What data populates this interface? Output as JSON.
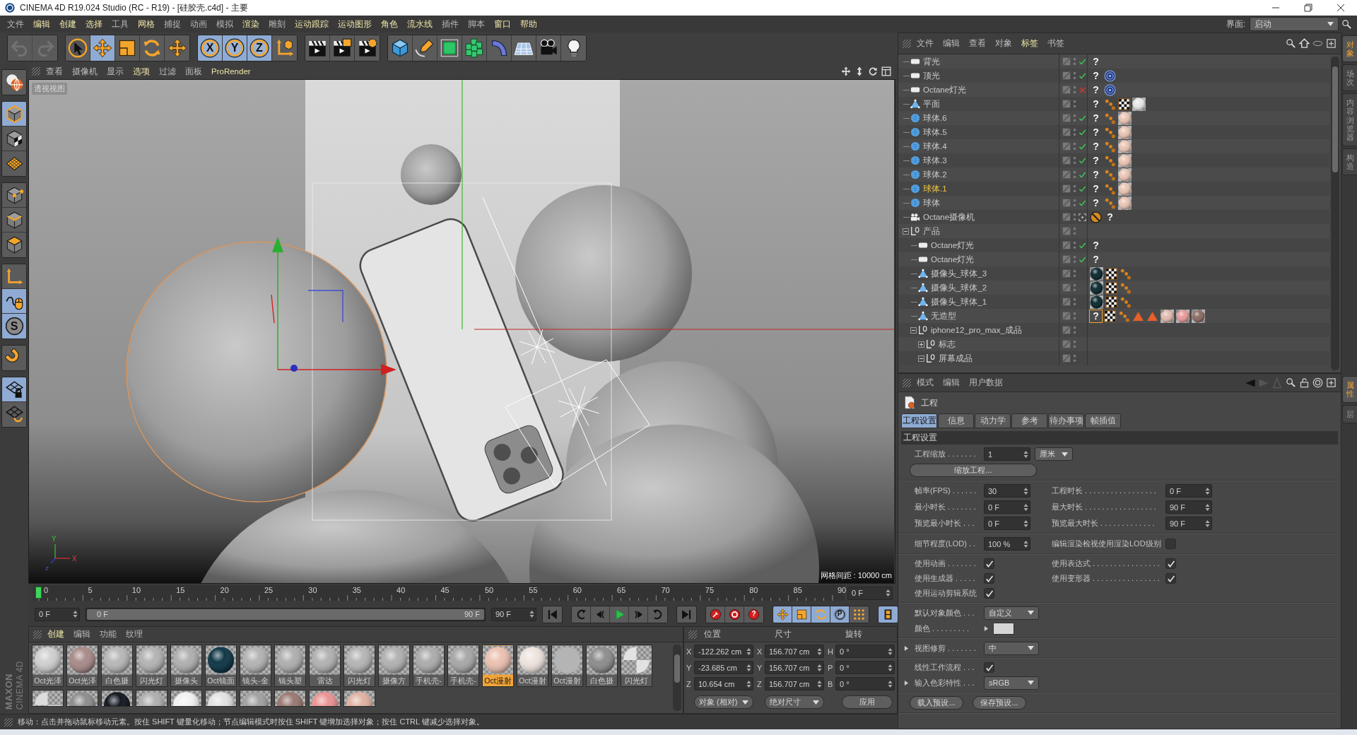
{
  "window": {
    "title": "CINEMA 4D R19.024 Studio (RC - R19) - [硅胶壳.c4d] - 主要"
  },
  "menu_bar": {
    "items": [
      {
        "label": "文件",
        "highlighted": false
      },
      {
        "label": "编辑",
        "highlighted": true
      },
      {
        "label": "创建",
        "highlighted": true
      },
      {
        "label": "选择",
        "highlighted": true
      },
      {
        "label": "工具",
        "highlighted": false
      },
      {
        "label": "网格",
        "highlighted": true
      },
      {
        "label": "捕捉",
        "highlighted": false
      },
      {
        "label": "动画",
        "highlighted": false
      },
      {
        "label": "模拟",
        "highlighted": false
      },
      {
        "label": "渲染",
        "highlighted": true
      },
      {
        "label": "雕刻",
        "highlighted": false
      },
      {
        "label": "运动跟踪",
        "highlighted": true
      },
      {
        "label": "运动图形",
        "highlighted": true
      },
      {
        "label": "角色",
        "highlighted": true
      },
      {
        "label": "流水线",
        "highlighted": true
      },
      {
        "label": "插件",
        "highlighted": false
      },
      {
        "label": "脚本",
        "highlighted": false
      },
      {
        "label": "窗口",
        "highlighted": true
      },
      {
        "label": "帮助",
        "highlighted": true
      }
    ],
    "layout_label": "界面:",
    "layout_value": "启动"
  },
  "toolbar": {
    "groups": [
      {
        "buttons": [
          {
            "kind": "undo",
            "selected": false,
            "disabled": true
          },
          {
            "kind": "redo",
            "selected": false,
            "disabled": true
          }
        ]
      },
      {
        "buttons": [
          {
            "kind": "select",
            "selected": false,
            "disabled": false
          },
          {
            "kind": "move",
            "selected": true,
            "disabled": false
          },
          {
            "kind": "scale",
            "selected": false,
            "disabled": false
          },
          {
            "kind": "rotate",
            "selected": false,
            "disabled": false
          },
          {
            "kind": "move",
            "selected": false,
            "disabled": false
          }
        ]
      },
      {
        "buttons": [
          {
            "kind": "axis",
            "label": "X",
            "selected": true,
            "disabled": false
          },
          {
            "kind": "axis",
            "label": "Y",
            "selected": true,
            "disabled": false
          },
          {
            "kind": "axis",
            "label": "Z",
            "selected": true,
            "disabled": false
          },
          {
            "kind": "coordinates",
            "selected": false,
            "disabled": false
          }
        ]
      },
      {
        "buttons": [
          {
            "kind": "render-view",
            "selected": false,
            "disabled": false
          },
          {
            "kind": "render-picture",
            "selected": false,
            "disabled": false
          },
          {
            "kind": "render-settings",
            "selected": false,
            "disabled": false
          }
        ]
      },
      {
        "buttons": [
          {
            "kind": "cube",
            "selected": false,
            "disabled": false
          },
          {
            "kind": "pen",
            "selected": false,
            "disabled": false
          },
          {
            "kind": "subdivision",
            "selected": false,
            "disabled": false
          },
          {
            "kind": "cloner",
            "selected": false,
            "disabled": false
          },
          {
            "kind": "deformer",
            "selected": false,
            "disabled": false
          },
          {
            "kind": "floor",
            "selected": false,
            "disabled": false
          },
          {
            "kind": "camera",
            "selected": false,
            "disabled": false
          },
          {
            "kind": "light",
            "selected": false,
            "disabled": false
          }
        ]
      }
    ]
  },
  "tool_strip": {
    "groups": [
      {
        "buttons": [
          {
            "kind": "make-editable",
            "selected": false
          }
        ]
      },
      {
        "buttons": [
          {
            "kind": "model",
            "selected": true
          },
          {
            "kind": "texture",
            "selected": false
          },
          {
            "kind": "workplane",
            "selected": false
          }
        ]
      },
      {
        "buttons": [
          {
            "kind": "points",
            "selected": false
          },
          {
            "kind": "edges",
            "selected": false
          },
          {
            "kind": "polygons",
            "selected": false
          }
        ]
      },
      {
        "buttons": [
          {
            "kind": "axis-mode",
            "selected": false
          },
          {
            "kind": "tweak",
            "selected": true
          },
          {
            "kind": "solo",
            "label": "S",
            "selected": true
          }
        ]
      },
      {
        "buttons": [
          {
            "kind": "snap",
            "selected": false
          }
        ]
      },
      {
        "buttons": [
          {
            "kind": "lock-workplane",
            "selected": true
          },
          {
            "kind": "planar-workplane",
            "selected": false
          }
        ]
      }
    ]
  },
  "viewport": {
    "menu": [
      {
        "label": "查看",
        "highlighted": false
      },
      {
        "label": "摄像机",
        "highlighted": false
      },
      {
        "label": "显示",
        "highlighted": false
      },
      {
        "label": "选项",
        "highlighted": true
      },
      {
        "label": "过滤",
        "highlighted": false
      },
      {
        "label": "面板",
        "highlighted": false
      },
      {
        "label": "ProRender",
        "highlighted": true
      }
    ],
    "view_name": "透视视图",
    "axis_labels": [
      "Y",
      "X",
      "Z"
    ],
    "grid_spacing": "网格间距 : 10000 cm"
  },
  "timeline": {
    "ticks": [
      "0",
      "5",
      "10",
      "15",
      "20",
      "25",
      "30",
      "35",
      "40",
      "45",
      "50",
      "55",
      "60",
      "65",
      "70",
      "75",
      "80",
      "85",
      "90"
    ],
    "level": 0,
    "current_frame": "0 F"
  },
  "transport": {
    "start": "0 F",
    "range": {
      "start": "0 F",
      "end": "90 F",
      "level": 1
    },
    "end": "90 F",
    "groups": [
      {
        "buttons": [
          {
            "kind": "first",
            "selected": false
          }
        ]
      },
      {
        "buttons": [
          {
            "kind": "prev-key",
            "selected": false
          },
          {
            "kind": "prev-frame",
            "selected": false
          },
          {
            "kind": "play",
            "selected": false
          },
          {
            "kind": "next-frame",
            "selected": false
          },
          {
            "kind": "next-key",
            "selected": false
          }
        ]
      },
      {
        "buttons": [
          {
            "kind": "last",
            "selected": false
          }
        ]
      },
      {
        "buttons": [
          {
            "kind": "record",
            "selected": false
          },
          {
            "kind": "autokey",
            "selected": false
          },
          {
            "kind": "key-help",
            "label": "?",
            "selected": false
          }
        ]
      },
      {
        "buttons": [
          {
            "kind": "move",
            "selected": true
          },
          {
            "kind": "scale",
            "selected": true
          },
          {
            "kind": "rotate",
            "selected": true
          },
          {
            "kind": "param",
            "label": "P",
            "selected": true
          },
          {
            "kind": "dot-grid",
            "selected": false
          }
        ]
      },
      {
        "buttons": [
          {
            "kind": "film",
            "selected": true
          }
        ]
      }
    ]
  },
  "materials": {
    "menu": [
      {
        "label": "创建",
        "highlighted": true
      },
      {
        "label": "编辑",
        "highlighted": false
      },
      {
        "label": "功能",
        "highlighted": false
      },
      {
        "label": "纹理",
        "highlighted": false
      }
    ],
    "items": [
      {
        "name": "Oct光泽",
        "kind": "sphere",
        "color": "#d0d0d0",
        "selected": false
      },
      {
        "name": "Oct光泽",
        "kind": "sphere",
        "color": "#a88c8a",
        "selected": false
      },
      {
        "name": "白色摄",
        "kind": "sphere",
        "color": "#b8b8b8",
        "selected": false
      },
      {
        "name": "闪光灯",
        "kind": "sphere",
        "color": "#b4b4b4",
        "selected": false
      },
      {
        "name": "摄像头",
        "kind": "sphere",
        "color": "#b0b0b0",
        "selected": false
      },
      {
        "name": "Oct镜面",
        "kind": "sphere",
        "color": "#123848",
        "selected": false
      },
      {
        "name": "镜头-金",
        "kind": "sphere",
        "color": "#b4b4b4",
        "selected": false
      },
      {
        "name": "镜头塑",
        "kind": "sphere",
        "color": "#b0b0b0",
        "selected": false
      },
      {
        "name": "雷达",
        "kind": "sphere",
        "color": "#b2b2b2",
        "selected": false
      },
      {
        "name": "闪光灯",
        "kind": "sphere",
        "color": "#b6b6b6",
        "selected": false
      },
      {
        "name": "摄像方",
        "kind": "sphere",
        "color": "#b2b2b2",
        "selected": false
      },
      {
        "name": "手机壳-",
        "kind": "sphere",
        "color": "#adadad",
        "selected": false
      },
      {
        "name": "手机壳-",
        "kind": "sphere",
        "color": "#a8a8a8",
        "selected": false
      },
      {
        "name": "Oct漫射",
        "kind": "sphere",
        "color": "#ecc2b2",
        "selected": true
      },
      {
        "name": "Oct漫射",
        "kind": "sphere",
        "color": "#eee4de",
        "selected": false
      },
      {
        "name": "Oct漫射",
        "kind": "flat",
        "color": "#b4b4b4",
        "selected": false
      },
      {
        "name": "白色摄",
        "kind": "sphere",
        "color": "#8e8e8e",
        "selected": false
      },
      {
        "name": "闪光灯",
        "kind": "checker",
        "color": "#e2e2e2",
        "selected": false
      }
    ],
    "items_row_2": [
      {
        "kind": "checker",
        "color": "#dcdcdc",
        "selected": false
      },
      {
        "kind": "sphere",
        "color": "#8e8e8e",
        "selected": false
      },
      {
        "kind": "sphere",
        "color": "#151a22",
        "selected": false
      },
      {
        "kind": "sphere",
        "color": "#b0b0b0",
        "selected": false
      },
      {
        "kind": "sphere",
        "color": "#f2f2f2",
        "selected": false
      },
      {
        "kind": "sphere",
        "color": "#e2e2e2",
        "selected": false
      },
      {
        "kind": "sphere",
        "color": "#a2a2a2",
        "selected": false
      },
      {
        "kind": "sphere",
        "color": "#9a7a72",
        "selected": false
      },
      {
        "kind": "sphere",
        "color": "#ea9494",
        "selected": false
      },
      {
        "kind": "sphere",
        "color": "#e0b2a4",
        "selected": false
      }
    ]
  },
  "coordinates": {
    "columns": [
      {
        "title": "位置",
        "fields": [
          {
            "axis": "X",
            "value": "-122.262 cm"
          },
          {
            "axis": "Y",
            "value": "-23.685 cm"
          },
          {
            "axis": "Z",
            "value": "10.654 cm"
          }
        ]
      },
      {
        "title": "尺寸",
        "fields": [
          {
            "axis": "X",
            "value": "156.707 cm"
          },
          {
            "axis": "Y",
            "value": "156.707 cm"
          },
          {
            "axis": "Z",
            "value": "156.707 cm"
          }
        ]
      },
      {
        "title": "旋转",
        "fields": [
          {
            "axis": "H",
            "value": "0 °"
          },
          {
            "axis": "P",
            "value": "0 °"
          },
          {
            "axis": "B",
            "value": "0 °"
          }
        ]
      }
    ],
    "mode_dropdowns": [
      "对象 (相对)",
      "绝对尺寸"
    ],
    "apply_button": "应用"
  },
  "status_bar": {
    "text": "移动：点击并拖动鼠标移动元素。按住 SHIFT 键量化移动；节点编辑模式时按住 SHIFT 键增加选择对象；按住 CTRL 键减少选择对象。"
  },
  "logo": {
    "brand": "MAXON",
    "product": "CINEMA 4D"
  },
  "object_manager": {
    "menu": [
      {
        "label": "文件",
        "highlighted": false
      },
      {
        "label": "编辑",
        "highlighted": false
      },
      {
        "label": "查看",
        "highlighted": false
      },
      {
        "label": "对象",
        "highlighted": false
      },
      {
        "label": "标签",
        "highlighted": true
      },
      {
        "label": "书签",
        "highlighted": false
      }
    ],
    "objects": [
      {
        "name": "背光",
        "kind": "light",
        "selected": false,
        "enabled": true,
        "tags": [
          {
            "kind": "text",
            "label": "?",
            "selected": false
          }
        ]
      },
      {
        "name": "顶光",
        "kind": "light",
        "selected": false,
        "enabled": true,
        "tags": [
          {
            "kind": "text",
            "label": "?",
            "selected": false
          },
          {
            "kind": "target",
            "selected": false
          }
        ]
      },
      {
        "name": "Octane灯光",
        "kind": "light",
        "selected": false,
        "enabled": false,
        "tags": [
          {
            "kind": "text",
            "label": "?",
            "selected": false
          },
          {
            "kind": "target",
            "selected": false
          }
        ]
      },
      {
        "name": "平面",
        "kind": "polygon",
        "selected": false,
        "tags": [
          {
            "kind": "text",
            "label": "?",
            "selected": false
          },
          {
            "kind": "dots",
            "selected": false
          },
          {
            "kind": "checker",
            "selected": false
          },
          {
            "kind": "material",
            "color": "#e8e6e4",
            "selected": false
          }
        ]
      },
      {
        "name": "球体.6",
        "kind": "sphere",
        "selected": false,
        "enabled": true,
        "tags": [
          {
            "kind": "text",
            "label": "?",
            "selected": false
          },
          {
            "kind": "dots",
            "selected": false
          },
          {
            "kind": "material",
            "color": "#eac6b6",
            "selected": false
          }
        ]
      },
      {
        "name": "球体.5",
        "kind": "sphere",
        "selected": false,
        "enabled": true,
        "tags": [
          {
            "kind": "text",
            "label": "?",
            "selected": false
          },
          {
            "kind": "dots",
            "selected": false
          },
          {
            "kind": "material",
            "color": "#eac6b6",
            "selected": false
          }
        ]
      },
      {
        "name": "球体.4",
        "kind": "sphere",
        "selected": false,
        "enabled": true,
        "tags": [
          {
            "kind": "text",
            "label": "?",
            "selected": false
          },
          {
            "kind": "dots",
            "selected": false
          },
          {
            "kind": "material",
            "color": "#eac6b6",
            "selected": false
          }
        ]
      },
      {
        "name": "球体.3",
        "kind": "sphere",
        "selected": false,
        "enabled": true,
        "tags": [
          {
            "kind": "text",
            "label": "?",
            "selected": false
          },
          {
            "kind": "dots",
            "selected": false
          },
          {
            "kind": "material",
            "color": "#eac6b6",
            "selected": false
          }
        ]
      },
      {
        "name": "球体.2",
        "kind": "sphere",
        "selected": false,
        "enabled": true,
        "tags": [
          {
            "kind": "text",
            "label": "?",
            "selected": false
          },
          {
            "kind": "dots",
            "selected": false
          },
          {
            "kind": "material",
            "color": "#eac6b6",
            "selected": false
          }
        ]
      },
      {
        "name": "球体.1",
        "kind": "sphere",
        "selected": true,
        "enabled": true,
        "tags": [
          {
            "kind": "text",
            "label": "?",
            "selected": false
          },
          {
            "kind": "dots",
            "selected": false
          },
          {
            "kind": "material",
            "color": "#eac6b6",
            "selected": false
          }
        ]
      },
      {
        "name": "球体",
        "kind": "sphere",
        "selected": false,
        "enabled": true,
        "tags": [
          {
            "kind": "text",
            "label": "?",
            "selected": false
          },
          {
            "kind": "dots",
            "selected": false
          },
          {
            "kind": "material",
            "color": "#eac6b6",
            "selected": false
          }
        ]
      },
      {
        "name": "Octane摄像机",
        "kind": "camera",
        "selected": false,
        "tags": [
          {
            "kind": "no-entry",
            "selected": false
          },
          {
            "kind": "text",
            "label": "?",
            "selected": false
          }
        ]
      },
      {
        "name": "产品",
        "kind": "null",
        "selected": false,
        "expanded": true,
        "children": [
          {
            "name": "Octane灯光",
            "kind": "light",
            "selected": false,
            "enabled": true,
            "tags": [
              {
                "kind": "text",
                "label": "?",
                "selected": false
              }
            ]
          },
          {
            "name": "Octane灯光",
            "kind": "light",
            "selected": false,
            "enabled": true,
            "tags": [
              {
                "kind": "text",
                "label": "?",
                "selected": false
              }
            ]
          },
          {
            "name": "摄像头_球体_3",
            "kind": "polygon",
            "selected": false,
            "tags": [
              {
                "kind": "material",
                "color": "#0f2c32",
                "selected": false
              },
              {
                "kind": "checker",
                "selected": false
              },
              {
                "kind": "dots",
                "selected": false
              }
            ]
          },
          {
            "name": "摄像头_球体_2",
            "kind": "polygon",
            "selected": false,
            "tags": [
              {
                "kind": "material",
                "color": "#0f2c32",
                "selected": false
              },
              {
                "kind": "checker",
                "selected": false
              },
              {
                "kind": "dots",
                "selected": false
              }
            ]
          },
          {
            "name": "摄像头_球体_1",
            "kind": "polygon",
            "selected": false,
            "tags": [
              {
                "kind": "material",
                "color": "#0f2c32",
                "selected": false
              },
              {
                "kind": "checker",
                "selected": false
              },
              {
                "kind": "dots",
                "selected": false
              }
            ]
          },
          {
            "name": "无造型",
            "kind": "polygon",
            "selected": false,
            "tags": [
              {
                "kind": "text",
                "label": "?",
                "selected": true
              },
              {
                "kind": "checker",
                "selected": false
              },
              {
                "kind": "dots",
                "selected": false
              },
              {
                "kind": "triangle",
                "selected": false
              },
              {
                "kind": "triangle",
                "selected": false
              },
              {
                "kind": "material",
                "color": "#e2bcb0",
                "selected": false
              },
              {
                "kind": "material",
                "color": "#e89c9c",
                "selected": false
              },
              {
                "kind": "material",
                "color": "#8c6e64",
                "selected": false
              }
            ]
          },
          {
            "name": "iphone12_pro_max_成品",
            "kind": "null",
            "selected": false,
            "expanded": true,
            "children": [
              {
                "name": "标志",
                "kind": "null",
                "selected": false,
                "expanded": false
              },
              {
                "name": "屏幕成品",
                "kind": "null",
                "selected": false,
                "expanded": true
              }
            ]
          }
        ]
      }
    ]
  },
  "attribute_manager": {
    "menu": [
      "模式",
      "编辑",
      "用户数据"
    ],
    "object_title": "工程",
    "tabs": [
      {
        "label": "工程设置",
        "selected": true
      },
      {
        "label": "信息",
        "selected": false
      },
      {
        "label": "动力学",
        "selected": false
      },
      {
        "label": "参考",
        "selected": false
      },
      {
        "label": "待办事项",
        "selected": false
      },
      {
        "label": "帧插值",
        "selected": false
      }
    ],
    "section_title": "工程设置",
    "groups": [
      {
        "rows": [
          {
            "cells": [
              {
                "kind": "number",
                "label": "工程缩放 . . . . . . .",
                "value": "1",
                "unit": "厘米"
              }
            ]
          },
          {
            "cells": [
              {
                "kind": "button",
                "label": "缩放工程..."
              }
            ]
          }
        ]
      },
      {
        "rows": [
          {
            "cells": [
              {
                "kind": "number",
                "label": "帧率(FPS) . . . . . .",
                "value": "30"
              },
              {
                "kind": "number",
                "label": "工程时长 . . . . . . . . . . . . . . . . .",
                "value": "0 F"
              }
            ]
          },
          {
            "cells": [
              {
                "kind": "number",
                "label": "最小时长 . . . . . . .",
                "value": "0 F"
              },
              {
                "kind": "number",
                "label": "最大时长 . . . . . . . . . . . . . . . . .",
                "value": "90 F"
              }
            ]
          },
          {
            "cells": [
              {
                "kind": "number",
                "label": "预览最小时长 . . .",
                "value": "0 F"
              },
              {
                "kind": "number",
                "label": "预览最大时长 . . . . . . . . . . . . .",
                "value": "90 F"
              }
            ]
          }
        ]
      },
      {
        "rows": [
          {
            "cells": [
              {
                "kind": "number",
                "label": "细节程度(LOD) . .",
                "value": "100 %"
              },
              {
                "kind": "check",
                "label": "编辑渲染检视使用渲染LOD级别",
                "checked": false
              }
            ]
          }
        ]
      },
      {
        "rows": [
          {
            "cells": [
              {
                "kind": "check",
                "label": "使用动画 . . . . . . .",
                "checked": true
              },
              {
                "kind": "check",
                "label": "使用表达式 . . . . . . . . . . . . . . . .",
                "checked": true
              }
            ]
          },
          {
            "cells": [
              {
                "kind": "check",
                "label": "使用生成器 . . . . .",
                "checked": true
              },
              {
                "kind": "check",
                "label": "使用变形器 . . . . . . . . . . . . . . . .",
                "checked": true
              }
            ]
          },
          {
            "cells": [
              {
                "kind": "check",
                "label": "使用运动剪辑系统",
                "checked": true
              }
            ]
          }
        ]
      },
      {
        "rows": [
          {
            "cells": [
              {
                "kind": "dropdown",
                "label": "默认对象颜色 . . .",
                "value": "自定义"
              }
            ]
          },
          {
            "cells": [
              {
                "kind": "color",
                "label": "颜色 . . . . . . . . .",
                "color": "#d6d6d6",
                "expander": true
              }
            ]
          }
        ]
      },
      {
        "rows": [
          {
            "cells": [
              {
                "kind": "dropdown",
                "label": "视图修剪 . . . . . . .",
                "value": "中",
                "expander": true
              }
            ]
          }
        ]
      },
      {
        "rows": [
          {
            "cells": [
              {
                "kind": "check",
                "label": "线性工作流程 . . .",
                "checked": true
              }
            ]
          },
          {
            "cells": [
              {
                "kind": "dropdown",
                "label": "输入色彩特性 . . .",
                "value": "sRGB",
                "expander": true
              }
            ]
          }
        ]
      },
      {
        "rows": [
          {
            "cells": [
              {
                "kind": "button",
                "label": "载入预设..."
              },
              {
                "kind": "button",
                "label": "保存预设..."
              }
            ]
          }
        ]
      }
    ]
  },
  "side_tabs": {
    "upper": [
      {
        "label": "对象",
        "selected": true
      },
      {
        "label": "场次",
        "selected": false
      },
      {
        "label": "内容浏览器",
        "selected": false
      },
      {
        "label": "构造",
        "selected": false
      }
    ],
    "lower": [
      {
        "label": "属性",
        "selected": true
      },
      {
        "label": "层",
        "selected": false
      }
    ]
  }
}
